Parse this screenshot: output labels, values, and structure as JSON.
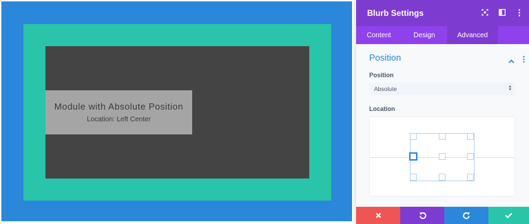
{
  "preview": {
    "module": {
      "title": "Module with Absolute Position",
      "subtitle": "Location: Left Center"
    }
  },
  "panel": {
    "title": "Blurb Settings",
    "header_icons": [
      "expand-icon",
      "sidebar-toggle-icon",
      "more-options-icon"
    ],
    "tabs": [
      {
        "label": "Content",
        "active": false
      },
      {
        "label": "Design",
        "active": false
      },
      {
        "label": "Advanced",
        "active": true
      }
    ],
    "section": {
      "title": "Position",
      "expanded": true
    },
    "position_field": {
      "label": "Position",
      "value": "Absolute"
    },
    "location_field": {
      "label": "Location",
      "selected": "Left Center"
    },
    "actions": [
      "cancel-icon",
      "undo-icon",
      "redo-icon",
      "save-check-icon"
    ]
  },
  "colors": {
    "blue": "#2b87da",
    "teal": "#29c4a9",
    "dark": "#444444",
    "module": "#a5a5a5",
    "purple": "#7e3bd0",
    "purple_tab_bar": "#8f42ec",
    "red": "#ef5555"
  }
}
